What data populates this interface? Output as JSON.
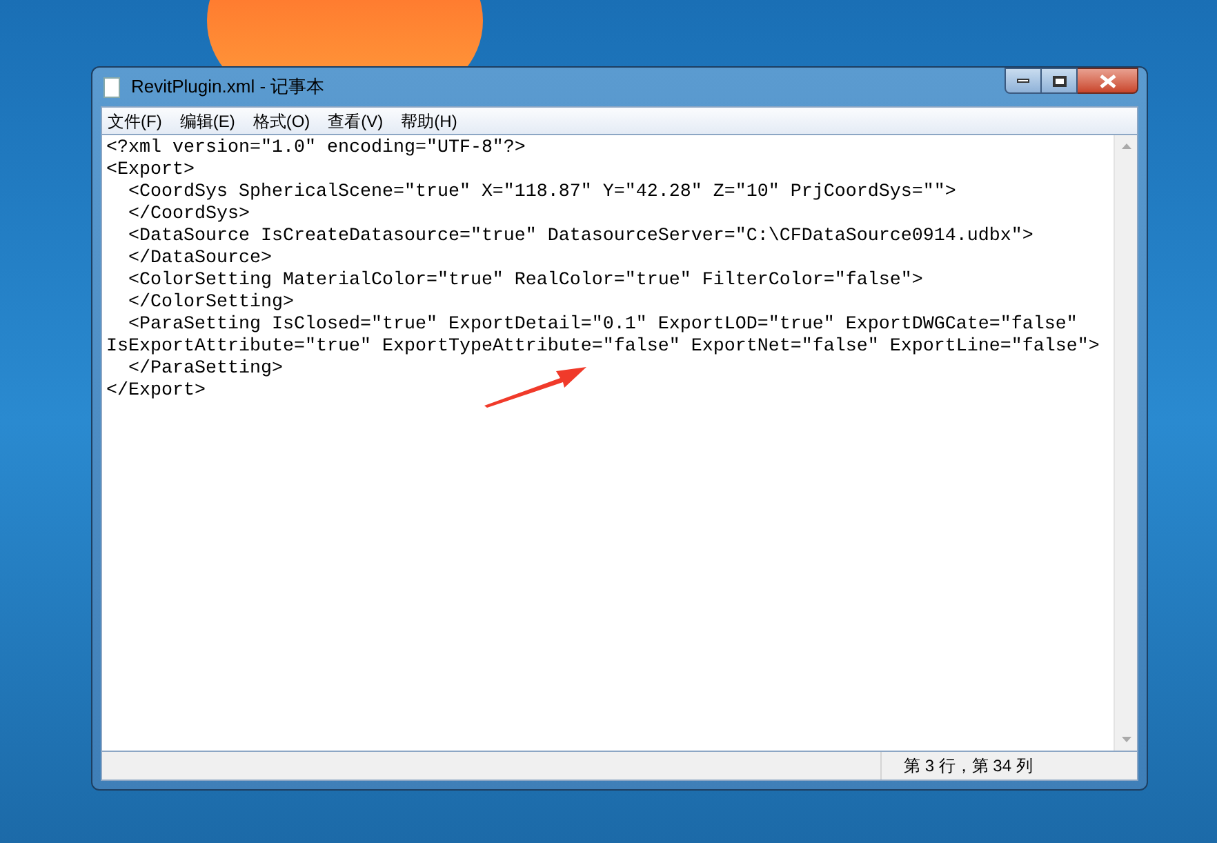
{
  "window": {
    "title": "RevitPlugin.xml - 记事本"
  },
  "menu": [
    {
      "label": "文件(F)"
    },
    {
      "label": "编辑(E)"
    },
    {
      "label": "格式(O)"
    },
    {
      "label": "查看(V)"
    },
    {
      "label": "帮助(H)"
    }
  ],
  "editor": {
    "lines": [
      "<?xml version=\"1.0\" encoding=\"UTF-8\"?>",
      "<Export>",
      "  <CoordSys SphericalScene=\"true\" X=\"118.87\" Y=\"42.28\" Z=\"10\" PrjCoordSys=\"\">",
      "  </CoordSys>",
      "  <DataSource IsCreateDatasource=\"true\" DatasourceServer=\"C:\\CFDataSource0914.udbx\">",
      "  </DataSource>",
      "  <ColorSetting MaterialColor=\"true\" RealColor=\"true\" FilterColor=\"false\">",
      "  </ColorSetting>",
      "  <ParaSetting IsClosed=\"true\" ExportDetail=\"0.1\" ExportLOD=\"true\" ExportDWGCate=\"false\"",
      "IsExportAttribute=\"true\" ExportTypeAttribute=\"false\" ExportNet=\"false\" ExportLine=\"false\">",
      "  </ParaSetting>",
      "</Export>"
    ]
  },
  "status_bar": {
    "position": "第 3 行，第 34 列"
  }
}
